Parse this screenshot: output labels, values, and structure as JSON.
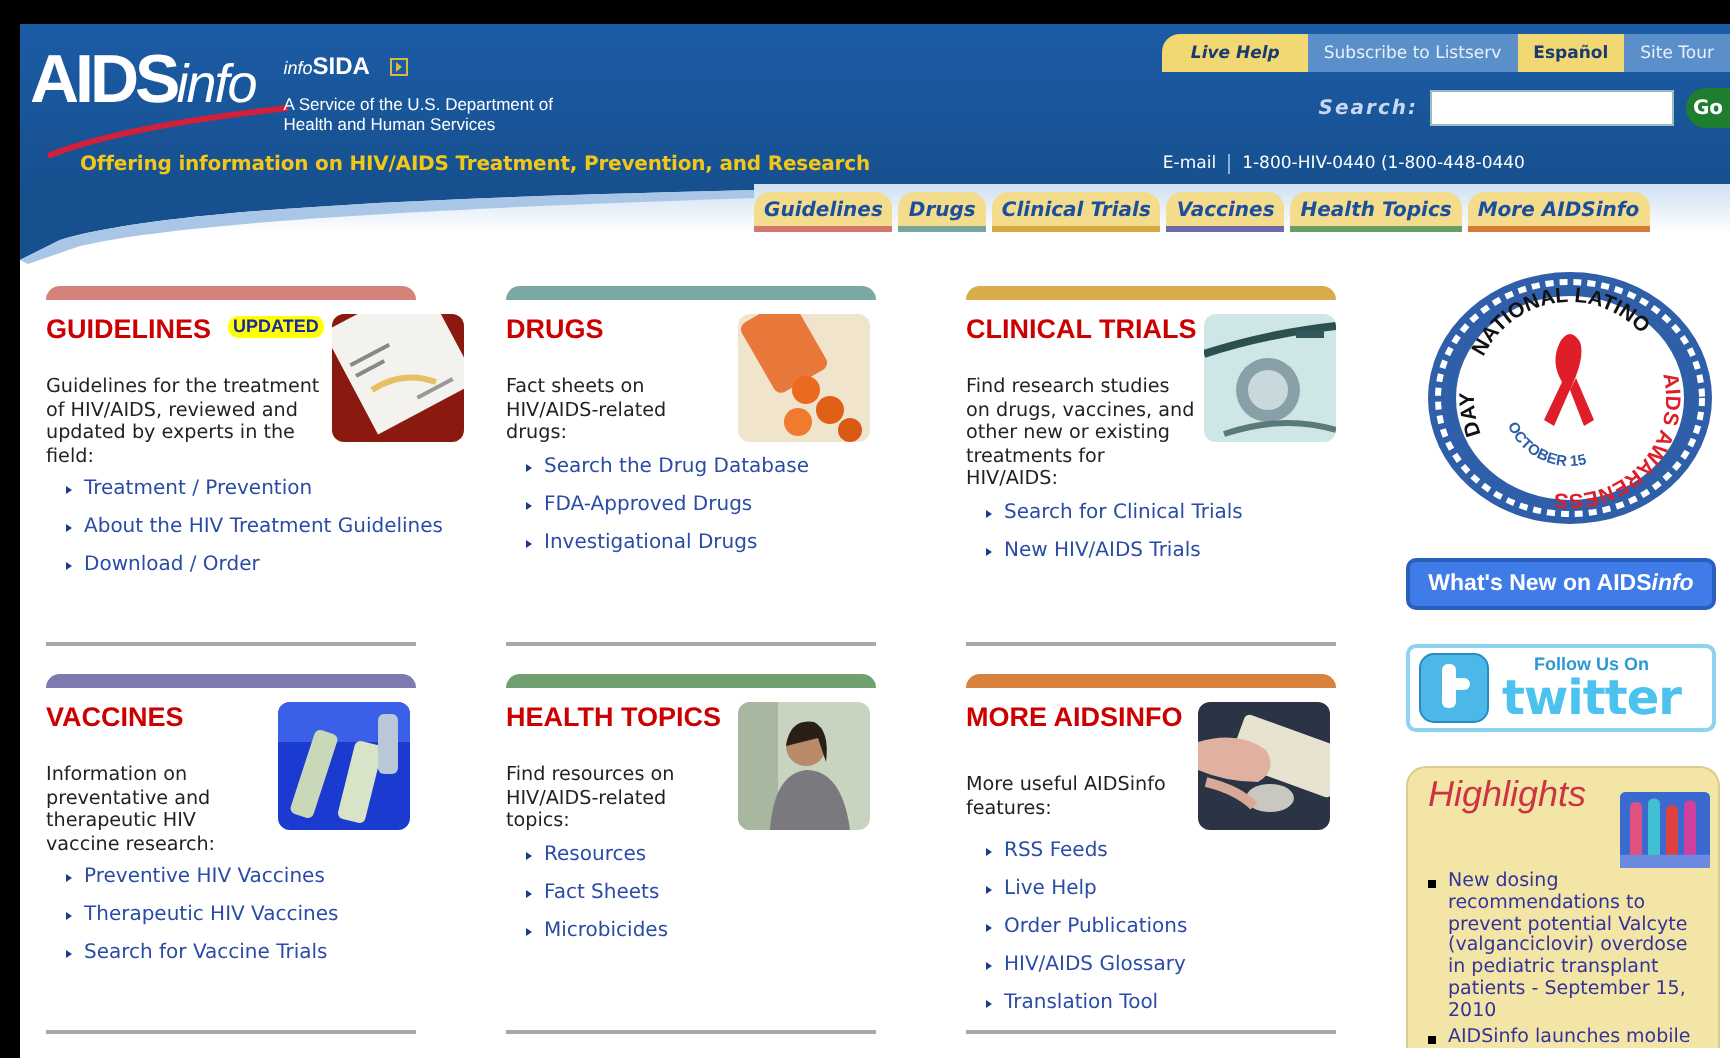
{
  "header": {
    "logo": {
      "main": "AIDS",
      "suffix": "info"
    },
    "sister_site": {
      "prefix": "info",
      "name": "SIDA"
    },
    "agency": "A Service of the U.S. Department of Health and Human Services",
    "tagline": "Offering information on HIV/AIDS Treatment, Prevention, and Research",
    "top_links": [
      {
        "label": "Live Help",
        "highlighted": true
      },
      {
        "label": "Subscribe to Listserv",
        "highlighted": false
      },
      {
        "label": "Español",
        "highlighted": true
      },
      {
        "label": "Site Tour",
        "highlighted": false
      }
    ],
    "search": {
      "label": "Search:",
      "button": "Go"
    },
    "contact": {
      "email": "E-mail",
      "phone": "1-800-HIV-0440 (1-800-448-0440"
    }
  },
  "tabs": [
    {
      "label": "Guidelines",
      "color": "#d4766e"
    },
    {
      "label": "Drugs",
      "color": "#76a69e"
    },
    {
      "label": "Clinical Trials",
      "color": "#d8a840"
    },
    {
      "label": "Vaccines",
      "color": "#6f6aa8"
    },
    {
      "label": "Health Topics",
      "color": "#6a9c68"
    },
    {
      "label": "More AIDSinfo",
      "color": "#d87a36"
    }
  ],
  "cards": [
    {
      "title": "GUIDELINES",
      "badge": "UPDATED",
      "color": "#d4827a",
      "description": "Guidelines for the treatment of HIV/AIDS, reviewed and updated by experts in the field:",
      "links": [
        "Treatment / Prevention",
        "About the HIV Treatment Guidelines",
        "Download / Order"
      ]
    },
    {
      "title": "DRUGS",
      "color": "#7aa8a2",
      "description": "Fact sheets on HIV/AIDS-related drugs:",
      "links": [
        "Search the Drug Database",
        "FDA-Approved Drugs",
        "Investigational Drugs"
      ]
    },
    {
      "title": "CLINICAL TRIALS",
      "color": "#d8ac4a",
      "description": "Find research studies on drugs, vaccines, and other new or existing treatments for HIV/AIDS:",
      "links": [
        "Search for Clinical Trials",
        "New HIV/AIDS Trials"
      ]
    },
    {
      "title": "VACCINES",
      "color": "#7e7ab0",
      "description": "Information on preventative and therapeutic HIV vaccine research:",
      "links": [
        "Preventive HIV Vaccines",
        "Therapeutic HIV Vaccines",
        "Search for Vaccine Trials"
      ]
    },
    {
      "title": "HEALTH TOPICS",
      "color": "#70a070",
      "description": "Find resources on HIV/AIDS-related topics:",
      "links": [
        "Resources",
        "Fact Sheets",
        "Microbicides"
      ]
    },
    {
      "title": "MORE AIDSINFO",
      "color": "#d8823e",
      "description": "More useful AIDSinfo features:",
      "links": [
        "RSS Feeds",
        "Live Help",
        "Order Publications",
        "HIV/AIDS Glossary",
        "Translation Tool"
      ]
    }
  ],
  "sidebar": {
    "emblem": {
      "top": "NATIONAL LATINO",
      "left": "DAY",
      "date": "OCTOBER 15",
      "right": "AIDS AWARENESS"
    },
    "whats_new": {
      "text": "What's New on AIDS",
      "suffix": "info"
    },
    "twitter": {
      "small": "Follow Us On",
      "large": "twitter"
    },
    "highlights": {
      "title": "Highlights",
      "items": [
        "New dosing recommendations to prevent potential Valcyte (valganciclovir) overdose in pediatric transplant patients - September 15, 2010",
        "AIDSinfo launches mobile"
      ]
    }
  }
}
